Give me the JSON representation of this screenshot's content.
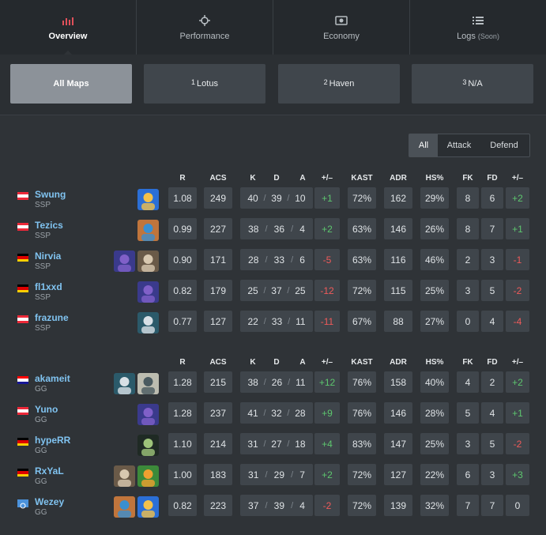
{
  "tabs": [
    {
      "label": "Overview",
      "icon": "bar-chart-icon",
      "active": true
    },
    {
      "label": "Performance",
      "icon": "crosshair-icon",
      "active": false
    },
    {
      "label": "Economy",
      "icon": "money-icon",
      "active": false
    },
    {
      "label": "Logs",
      "suffix": "(Soon)",
      "icon": "list-icon",
      "active": false
    }
  ],
  "maps": [
    {
      "num": "",
      "label": "All Maps",
      "active": true
    },
    {
      "num": "1",
      "label": "Lotus",
      "active": false
    },
    {
      "num": "2",
      "label": "Haven",
      "active": false
    },
    {
      "num": "3",
      "label": "N/A",
      "active": false
    }
  ],
  "side_filter": {
    "all": "All",
    "attack": "Attack",
    "defend": "Defend"
  },
  "headers": {
    "r": "R",
    "acs": "ACS",
    "k": "K",
    "d": "D",
    "a": "A",
    "pm": "+/–",
    "kast": "KAST",
    "adr": "ADR",
    "hs": "HS%",
    "fk": "FK",
    "fd": "FD",
    "pm2": "+/–"
  },
  "colors": {
    "positive": "#5dc66e",
    "negative": "#ef5a5a",
    "name": "#80c3f0",
    "accent": "#e0505a"
  },
  "teams": [
    {
      "players": [
        {
          "name": "Swung",
          "team": "SSP",
          "flag": "austria",
          "agents": [
            "neon"
          ],
          "r": "1.08",
          "acs": "249",
          "k": "40",
          "d": "39",
          "a": "10",
          "pm": "+1",
          "kast": "72%",
          "adr": "162",
          "hs": "29%",
          "fk": "8",
          "fd": "6",
          "fkpm": "+2"
        },
        {
          "name": "Tezics",
          "team": "SSP",
          "flag": "austria",
          "agents": [
            "kayo"
          ],
          "r": "0.99",
          "acs": "227",
          "k": "38",
          "d": "36",
          "a": "4",
          "pm": "+2",
          "kast": "63%",
          "adr": "146",
          "hs": "26%",
          "fk": "8",
          "fd": "7",
          "fkpm": "+1"
        },
        {
          "name": "Nirvia",
          "team": "SSP",
          "flag": "germany",
          "agents": [
            "omen",
            "chamber"
          ],
          "r": "0.90",
          "acs": "171",
          "k": "28",
          "d": "33",
          "a": "6",
          "pm": "-5",
          "kast": "63%",
          "adr": "116",
          "hs": "46%",
          "fk": "2",
          "fd": "3",
          "fkpm": "-1"
        },
        {
          "name": "fl1xxd",
          "team": "SSP",
          "flag": "germany",
          "agents": [
            "omen"
          ],
          "r": "0.82",
          "acs": "179",
          "k": "25",
          "d": "37",
          "a": "25",
          "pm": "-12",
          "kast": "72%",
          "adr": "115",
          "hs": "25%",
          "fk": "3",
          "fd": "5",
          "fkpm": "-2"
        },
        {
          "name": "frazune",
          "team": "SSP",
          "flag": "austria",
          "agents": [
            "harbor"
          ],
          "r": "0.77",
          "acs": "127",
          "k": "22",
          "d": "33",
          "a": "11",
          "pm": "-11",
          "kast": "67%",
          "adr": "88",
          "hs": "27%",
          "fk": "0",
          "fd": "4",
          "fkpm": "-4"
        }
      ]
    },
    {
      "players": [
        {
          "name": "akameit",
          "team": "GG",
          "flag": "croatia",
          "agents": [
            "harbor",
            "deadlock"
          ],
          "r": "1.28",
          "acs": "215",
          "k": "38",
          "d": "26",
          "a": "11",
          "pm": "+12",
          "kast": "76%",
          "adr": "158",
          "hs": "40%",
          "fk": "4",
          "fd": "2",
          "fkpm": "+2"
        },
        {
          "name": "Yuno",
          "team": "GG",
          "flag": "austria",
          "agents": [
            "omen"
          ],
          "r": "1.28",
          "acs": "237",
          "k": "41",
          "d": "32",
          "a": "28",
          "pm": "+9",
          "kast": "76%",
          "adr": "146",
          "hs": "28%",
          "fk": "5",
          "fd": "4",
          "fkpm": "+1"
        },
        {
          "name": "hypeRR",
          "team": "GG",
          "flag": "germany",
          "agents": [
            "viper"
          ],
          "r": "1.10",
          "acs": "214",
          "k": "31",
          "d": "27",
          "a": "18",
          "pm": "+4",
          "kast": "83%",
          "adr": "147",
          "hs": "25%",
          "fk": "3",
          "fd": "5",
          "fkpm": "-2"
        },
        {
          "name": "RxYaL",
          "team": "GG",
          "flag": "germany",
          "agents": [
            "chamber",
            "gekko"
          ],
          "r": "1.00",
          "acs": "183",
          "k": "31",
          "d": "29",
          "a": "7",
          "pm": "+2",
          "kast": "72%",
          "adr": "127",
          "hs": "22%",
          "fk": "6",
          "fd": "3",
          "fkpm": "+3"
        },
        {
          "name": "Wezey",
          "team": "GG",
          "flag": "un",
          "agents": [
            "kayo",
            "neon"
          ],
          "r": "0.82",
          "acs": "223",
          "k": "37",
          "d": "39",
          "a": "4",
          "pm": "-2",
          "kast": "72%",
          "adr": "139",
          "hs": "32%",
          "fk": "7",
          "fd": "7",
          "fkpm": "0"
        }
      ]
    }
  ]
}
